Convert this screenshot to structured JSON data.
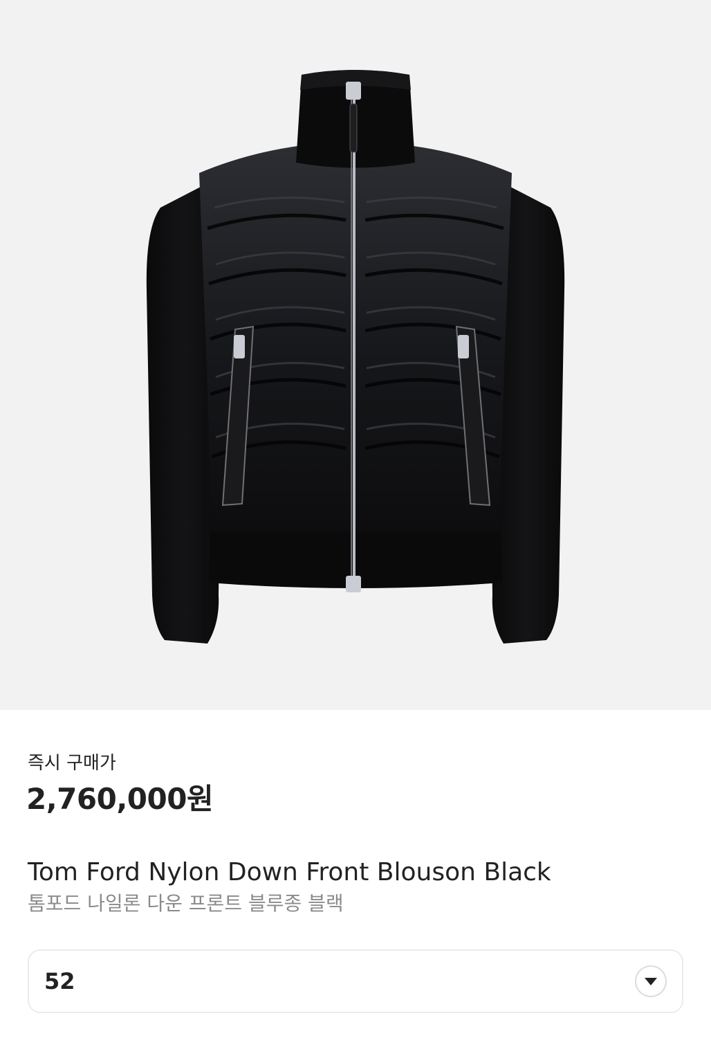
{
  "product": {
    "image_alt": "Tom Ford Nylon Down Front Blouson Black",
    "price_label": "즉시 구매가",
    "price": "2,760,000원",
    "name_en": "Tom Ford Nylon Down Front Blouson Black",
    "name_ko": "톰포드 나일론 다운 프론트 블루종 블랙"
  },
  "size_select": {
    "value": "52",
    "icon": "chevron-down-icon"
  },
  "colors": {
    "image_background": "#f2f2f2",
    "text_primary": "#222222",
    "text_secondary": "#8a8a8a",
    "border": "#ebebeb"
  }
}
